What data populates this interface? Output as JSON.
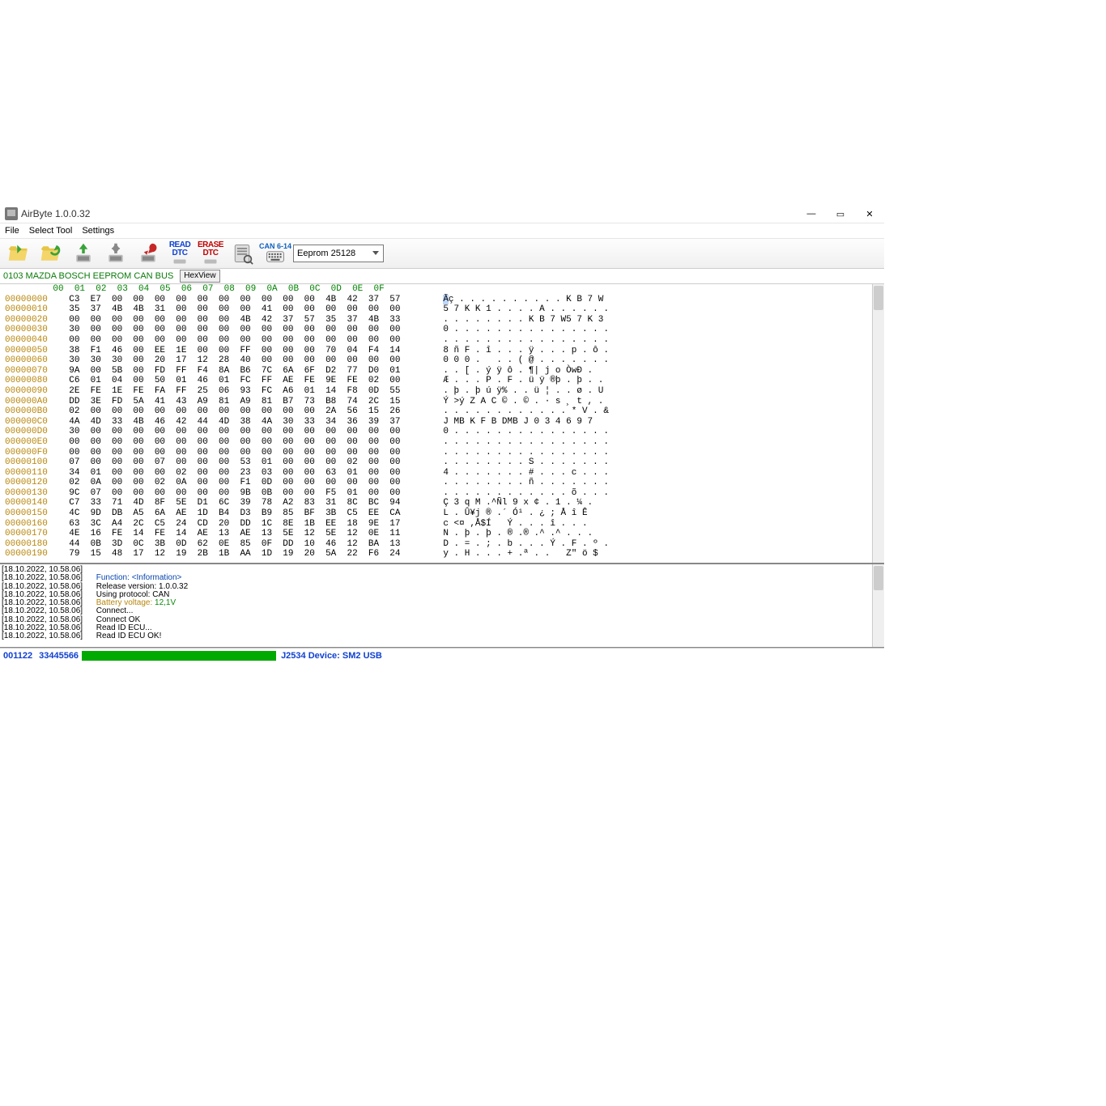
{
  "window": {
    "title": "AirByte  1.0.0.32"
  },
  "menu": {
    "file": "File",
    "select_tool": "Select Tool",
    "settings": "Settings"
  },
  "toolbar": {
    "read_dtc_1": "READ",
    "read_dtc_2": "DTC",
    "erase_dtc_1": "ERASE",
    "erase_dtc_2": "DTC",
    "can_label": "CAN 6-14",
    "combo": "Eeprom 25128"
  },
  "infobar": {
    "text": "0103 MAZDA BOSCH EEPROM CAN BUS",
    "hex_btn": "HexView"
  },
  "hex": {
    "header": "         00  01  02  03  04  05  06  07  08  09  0A  0B  0C  0D  0E  0F",
    "rows": [
      {
        "a": "00000000",
        "b": "C3  E7  00  00  00  00  00  00  00  00  00  00  4B  42  37  57",
        "t": "Ãç . . . . . . . . . . K B 7 W"
      },
      {
        "a": "00000010",
        "b": "35  37  4B  4B  31  00  00  00  00  41  00  00  00  00  00  00",
        "t": "5 7 K K 1 . . . . A . . . . . ."
      },
      {
        "a": "00000020",
        "b": "00  00  00  00  00  00  00  00  4B  42  37  57  35  37  4B  33",
        "t": ". . . . . . . . K B 7 W5 7 K 3"
      },
      {
        "a": "00000030",
        "b": "30  00  00  00  00  00  00  00  00  00  00  00  00  00  00  00",
        "t": "0 . . . . . . . . . . . . . . ."
      },
      {
        "a": "00000040",
        "b": "00  00  00  00  00  00  00  00  00  00  00  00  00  00  00  00",
        "t": ". . . . . . . . . . . . . . . ."
      },
      {
        "a": "00000050",
        "b": "38  F1  46  00  EE  1E  00  00  FF  00  00  00  70  04  F4  14",
        "t": "8 ñ F . î . . . ÿ . . . p . ô ."
      },
      {
        "a": "00000060",
        "b": "30  30  30  00  20  17  12  28  40  00  00  00  00  00  00  00",
        "t": "0 0 0 .   . . ( @ . . . . . . ."
      },
      {
        "a": "00000070",
        "b": "9A  00  5B  00  FD  FF  F4  8A  B6  7C  6A  6F  D2  77  D0  01",
        "t": ". . [ . ý ÿ ô . ¶| j o ÒwÐ ."
      },
      {
        "a": "00000080",
        "b": "C6  01  04  00  50  01  46  01  FC  FF  AE  FE  9E  FE  02  00",
        "t": "Æ . . . P . F . ü ÿ ®þ . þ . ."
      },
      {
        "a": "00000090",
        "b": "2E  FE  1E  FE  FA  FF  25  06  93  FC  A6  01  14  F8  0D  55",
        "t": ". þ . þ ú ÿ% . . ü ¦ . . ø . U"
      },
      {
        "a": "000000A0",
        "b": "DD  3E  FD  5A  41  43  A9  81  A9  81  B7  73  B8  74  2C  15",
        "t": "Ý >ý Z A C © . © . · s ¸ t , ."
      },
      {
        "a": "000000B0",
        "b": "02  00  00  00  00  00  00  00  00  00  00  00  2A  56  15  26",
        "t": ". . . . . . . . . . . . * V . &"
      },
      {
        "a": "000000C0",
        "b": "4A  4D  33  4B  46  42  44  4D  38  4A  30  33  34  36  39  37",
        "t": "J MB K F B DMB J 0 3 4 6 9 7"
      },
      {
        "a": "000000D0",
        "b": "30  00  00  00  00  00  00  00  00  00  00  00  00  00  00  00",
        "t": "0 . . . . . . . . . . . . . . ."
      },
      {
        "a": "000000E0",
        "b": "00  00  00  00  00  00  00  00  00  00  00  00  00  00  00  00",
        "t": ". . . . . . . . . . . . . . . ."
      },
      {
        "a": "000000F0",
        "b": "00  00  00  00  00  00  00  00  00  00  00  00  00  00  00  00",
        "t": ". . . . . . . . . . . . . . . ."
      },
      {
        "a": "00000100",
        "b": "07  00  00  00  07  00  00  00  53  01  00  00  00  02  00  00",
        "t": ". . . . . . . . S . . . . . . ."
      },
      {
        "a": "00000110",
        "b": "34  01  00  00  00  02  00  00  23  03  00  00  63  01  00  00",
        "t": "4 . . . . . . . # . . . c . . ."
      },
      {
        "a": "00000120",
        "b": "02  0A  00  00  02  0A  00  00  F1  0D  00  00  00  00  00  00",
        "t": ". . . . . . . . ñ . . . . . . ."
      },
      {
        "a": "00000130",
        "b": "9C  07  00  00  00  00  00  00  9B  0B  00  00  F5  01  00  00",
        "t": ". . . . . . . . . . . . õ . . ."
      },
      {
        "a": "00000140",
        "b": "C7  33  71  4D  8F  5E  D1  6C  39  78  A2  83  31  8C  BC  94",
        "t": "Ç 3 q M .^Ñl 9 x ¢ . 1 . ¼ ."
      },
      {
        "a": "00000150",
        "b": "4C  9D  DB  A5  6A  AE  1D  B4  D3  B9  85  BF  3B  C5  EE  CA",
        "t": "L . Û¥j ® .´ Ó¹ . ¿ ; Å î Ê"
      },
      {
        "a": "00000160",
        "b": "63  3C  A4  2C  C5  24  CD  20  DD  1C  8E  1B  EE  18  9E  17",
        "t": "c <¤ ,Å$Í   Ý . . . î . . ."
      },
      {
        "a": "00000170",
        "b": "4E  16  FE  14  FE  14  AE  13  AE  13  5E  12  5E  12  0E  11",
        "t": "N . þ . þ . ® .® .^ .^ . . ."
      },
      {
        "a": "00000180",
        "b": "44  0B  3D  0C  3B  0D  62  0E  85  0F  DD  10  46  12  BA  13",
        "t": "D . = . ; . b . . . Ý . F . º ."
      },
      {
        "a": "00000190",
        "b": "79  15  48  17  12  19  2B  1B  AA  1D  19  20  5A  22  F6  24",
        "t": "y . H . . . + .ª . .   Z\" ö $"
      }
    ]
  },
  "log": [
    {
      "ts": "[18.10.2022, 10.58.06]",
      "t": ""
    },
    {
      "ts": "[18.10.2022, 10.58.06]",
      "k": "Function: ",
      "v": "<Information>",
      "cls": "kv"
    },
    {
      "ts": "[18.10.2022, 10.58.06]",
      "t": "Release version: 1.0.0.32"
    },
    {
      "ts": "[18.10.2022, 10.58.06]",
      "t": "Using protocol: CAN"
    },
    {
      "ts": "[18.10.2022, 10.58.06]",
      "k": "Battery voltage: ",
      "v": "12,1V",
      "cls": "warn"
    },
    {
      "ts": "[18.10.2022, 10.58.06]",
      "t": "Connect..."
    },
    {
      "ts": "[18.10.2022, 10.58.06]",
      "t": "Connect OK"
    },
    {
      "ts": "[18.10.2022, 10.58.06]",
      "t": "Read ID ECU..."
    },
    {
      "ts": "[18.10.2022, 10.58.06]",
      "t": "Read ID ECU OK!"
    }
  ],
  "status": {
    "code1": "001122",
    "code2": "33445566",
    "device": "J2534 Device: SM2 USB"
  }
}
